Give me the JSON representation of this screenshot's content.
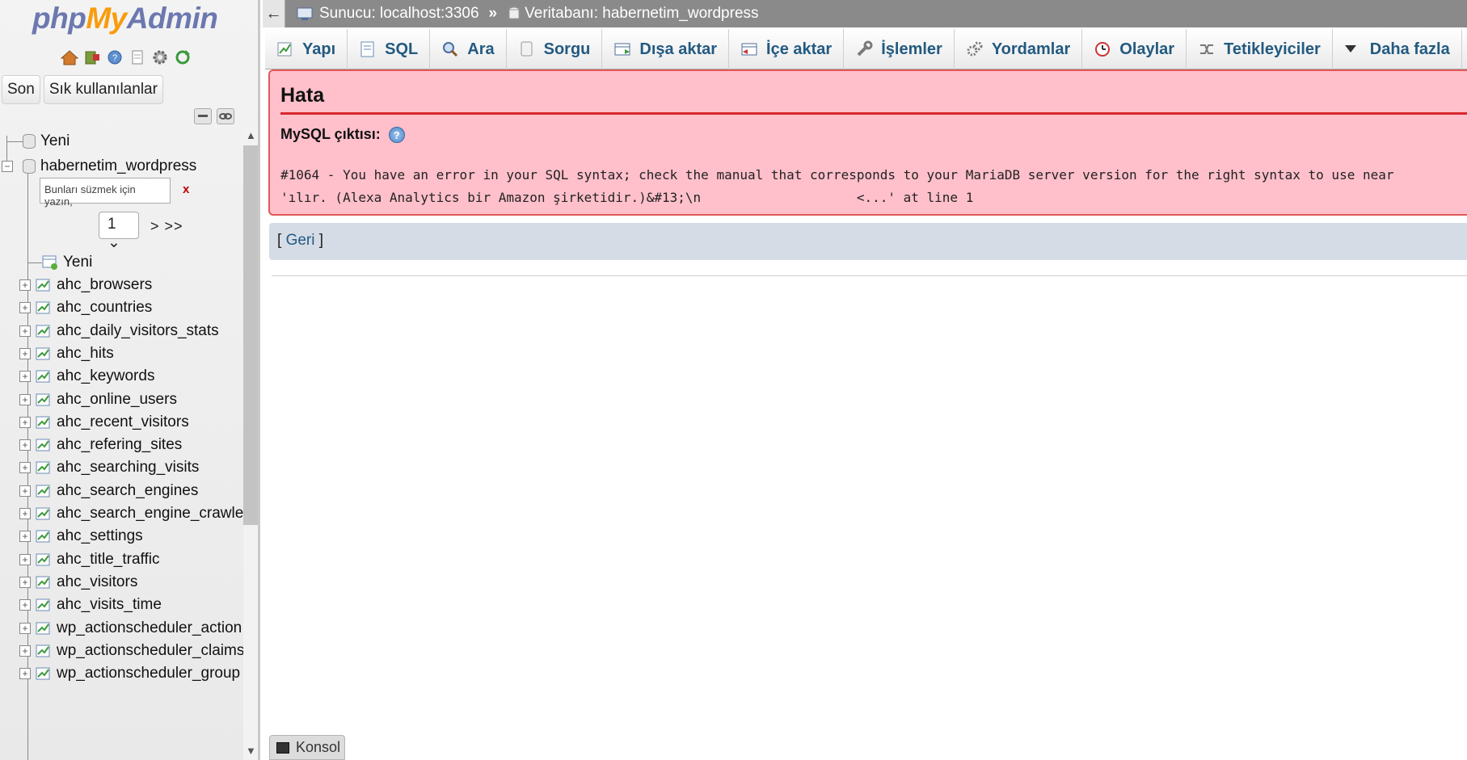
{
  "logo": {
    "php": "php",
    "my": "My",
    "admin": "Admin"
  },
  "quick_icons": [
    "home-icon",
    "exit-icon",
    "help-icon",
    "docs-icon",
    "settings-icon",
    "reload-icon"
  ],
  "recent_tabs": {
    "recent": "Son",
    "favorites": "Sık kullanılanlar"
  },
  "tree": {
    "new_top": "Yeni",
    "database": "habernetim_wordpress",
    "filter_placeholder": "Bunları süzmek için yazın,",
    "filter_clear": "x",
    "page_value": "1 ⌄",
    "page_next": "> >>",
    "new_table": "Yeni",
    "tables": [
      "ahc_browsers",
      "ahc_countries",
      "ahc_daily_visitors_stats",
      "ahc_hits",
      "ahc_keywords",
      "ahc_online_users",
      "ahc_recent_visitors",
      "ahc_refering_sites",
      "ahc_searching_visits",
      "ahc_search_engines",
      "ahc_search_engine_crawle",
      "ahc_settings",
      "ahc_title_traffic",
      "ahc_visitors",
      "ahc_visits_time",
      "wp_actionscheduler_action",
      "wp_actionscheduler_claims",
      "wp_actionscheduler_group"
    ]
  },
  "topbar": {
    "back": "←",
    "server": "Sunucu: localhost:3306",
    "separator": "»",
    "database": "Veritabanı: habernetim_wordpress"
  },
  "tabs": [
    {
      "label": "Yapı",
      "icon": "structure-icon"
    },
    {
      "label": "SQL",
      "icon": "sql-icon"
    },
    {
      "label": "Ara",
      "icon": "search-icon"
    },
    {
      "label": "Sorgu",
      "icon": "query-icon"
    },
    {
      "label": "Dışa aktar",
      "icon": "export-icon"
    },
    {
      "label": "İçe aktar",
      "icon": "import-icon"
    },
    {
      "label": "İşlemler",
      "icon": "wrench-icon"
    },
    {
      "label": "Yordamlar",
      "icon": "routines-icon"
    },
    {
      "label": "Olaylar",
      "icon": "events-icon"
    },
    {
      "label": "Tetikleyiciler",
      "icon": "triggers-icon"
    },
    {
      "label": "Daha fazla",
      "icon": "triangle-down-icon"
    }
  ],
  "error": {
    "title": "Hata",
    "mysql_label": "MySQL çıktısı:",
    "line1": "#1064 - You have an error in your SQL syntax; check the manual that corresponds to your MariaDB server version for the right syntax to use near",
    "line2": "'ılır. (Alexa Analytics bir Amazon şirketidir.)&#13;\\n                    <...' at line 1"
  },
  "back_link": {
    "open": "[ ",
    "label": "Geri",
    "close": " ]"
  },
  "console": {
    "label": "Konsol"
  },
  "colors": {
    "error_bg": "#ffc0cb",
    "error_border": "#d9262f",
    "link": "#235a81",
    "topbar": "#8a8a8a",
    "backbar": "#d5dce6"
  }
}
